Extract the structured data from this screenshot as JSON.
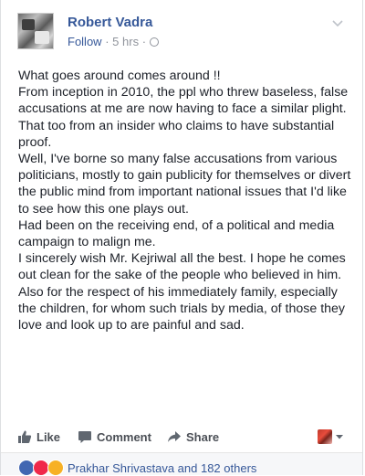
{
  "post": {
    "author": "Robert Vadra",
    "follow_label": "Follow",
    "time": "5 hrs",
    "separator": "·",
    "paragraphs": [
      "What goes around comes around !!",
      "From inception in 2010, the ppl who threw baseless, false accusations at me are now having to face a similar plight. That too from an insider who claims to have substantial proof.",
      "Well, I've borne so many false accusations from various politicians, mostly to gain publicity for themselves or divert the public mind from important national issues that I'd like to see how this one plays out.",
      "Had been on the receiving end, of a political and media campaign to malign me.",
      "I sincerely wish Mr. Kejriwal all the best. I hope he comes out clean for the sake of the people who believed in him.",
      "Also for the respect of his immediately family, especially the children, for whom such trials by media, of those they love and look up to are painful and sad."
    ]
  },
  "actions": {
    "like_label": "Like",
    "comment_label": "Comment",
    "share_label": "Share"
  },
  "reactions": {
    "icons": [
      "like-reaction-icon",
      "love-reaction-icon",
      "sad-reaction-icon"
    ],
    "summary": "Prakhar Shrivastava and 182 others"
  },
  "colors": {
    "link": "#365899",
    "meta": "#90949c",
    "text": "#1d2129",
    "action": "#4b4f56",
    "footer_bg": "#f6f7f9"
  }
}
